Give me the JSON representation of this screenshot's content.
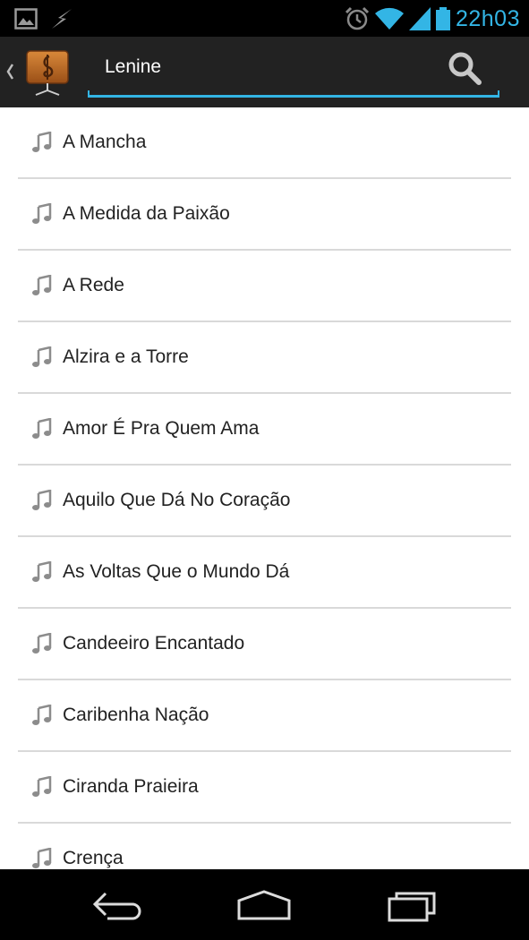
{
  "status_bar": {
    "time": "22h03",
    "left_icons": [
      "image-notification-icon",
      "bolt-notification-icon"
    ],
    "right_icons": [
      "alarm-icon",
      "wifi-icon",
      "signal-icon",
      "battery-icon"
    ],
    "accent_color": "#33b5e5"
  },
  "action_bar": {
    "up_icon": "up-caret-icon",
    "app_icon": "treble-clef-music-stand-icon",
    "search_query": "Lenine",
    "search_icon": "search-icon"
  },
  "songs": [
    {
      "title": "A Mancha"
    },
    {
      "title": "A Medida da Paixão"
    },
    {
      "title": "A Rede"
    },
    {
      "title": "Alzira e a Torre"
    },
    {
      "title": "Amor É Pra Quem Ama"
    },
    {
      "title": "Aquilo Que Dá No Coração"
    },
    {
      "title": "As Voltas Que o Mundo Dá"
    },
    {
      "title": "Candeeiro Encantado"
    },
    {
      "title": "Caribenha Nação"
    },
    {
      "title": "Ciranda Praieira"
    },
    {
      "title": "Crença"
    }
  ],
  "nav_bar": {
    "buttons": [
      "back-icon",
      "home-icon",
      "recent-apps-icon"
    ]
  }
}
